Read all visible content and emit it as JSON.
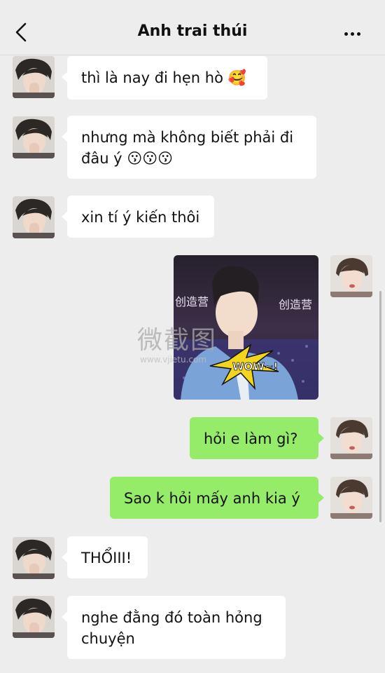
{
  "header": {
    "title": "Anh trai thúi",
    "back_icon": "chevron-left-icon",
    "more_icon": "more-dots-icon"
  },
  "messages": [
    {
      "side": "left",
      "text": "thì là nay đi hẹn hò",
      "emoji": "🥰"
    },
    {
      "side": "left",
      "text": "nhưng mà không biết phải đi đâu ý",
      "emoji": "😗😗😗"
    },
    {
      "side": "left",
      "text": "xin tí ý kiến thôi"
    },
    {
      "side": "right",
      "type": "sticker",
      "sticker_text": "WOW~!",
      "banner_text": "创造营"
    },
    {
      "side": "right",
      "text": "hỏi e làm gì?"
    },
    {
      "side": "right",
      "text": "Sao k hỏi mấy anh kia ý"
    },
    {
      "side": "left",
      "text": "THỔIII!"
    },
    {
      "side": "left",
      "text": "nghe đằng đó toàn hỏng chuyện"
    }
  ],
  "watermark": {
    "text": "微截图",
    "url": "www.vjietu.com"
  },
  "colors": {
    "background": "#ededed",
    "sent_bubble": "#95ec69",
    "received_bubble": "#ffffff"
  }
}
